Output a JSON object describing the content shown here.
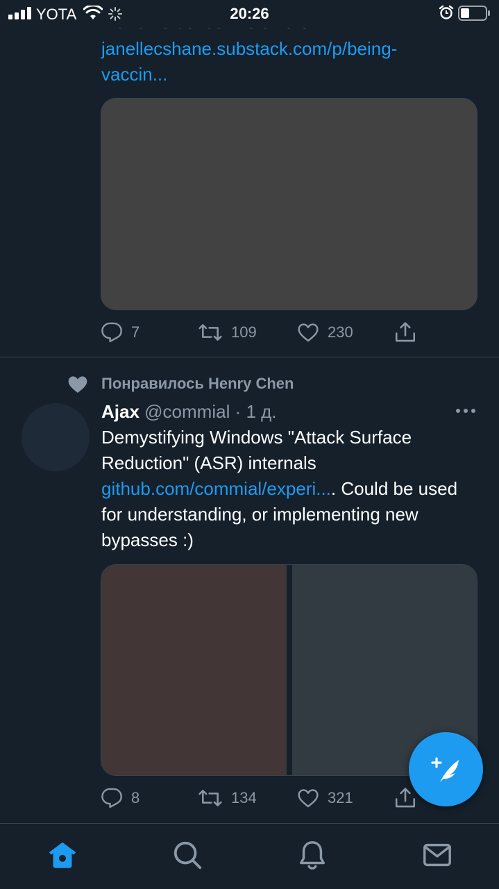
{
  "status_bar": {
    "carrier": "YOTA",
    "time": "20:26"
  },
  "tweet_prev": {
    "cut_text": "make no sense. Be smart!",
    "link_line1": "janellecshane.substack.com/p/being-",
    "link_line2": "vaccin...",
    "actions": {
      "replies": "7",
      "retweets": "109",
      "likes": "230"
    }
  },
  "tweet": {
    "social_context": "Понравилось Henry Chen",
    "name": "Ajax",
    "handle": "@commial",
    "separator": " · ",
    "time": "1 д.",
    "text_part1": "Demystifying Windows \"Attack Surface Reduction\" (ASR) internals ",
    "link_text": "github.com/commial/experi...",
    "text_part2": ". Could be used for understanding, or implementing new bypasses :)",
    "actions": {
      "replies": "8",
      "retweets": "134",
      "likes": "321"
    }
  },
  "icons": {
    "tab_home": "home-icon",
    "tab_search": "search-icon",
    "tab_notifications": "bell-icon",
    "tab_messages": "envelope-icon",
    "compose": "compose-tweet-icon"
  },
  "colors": {
    "background": "#15202b",
    "accent": "#1d9bf0",
    "secondary_text": "#8b98a5"
  }
}
